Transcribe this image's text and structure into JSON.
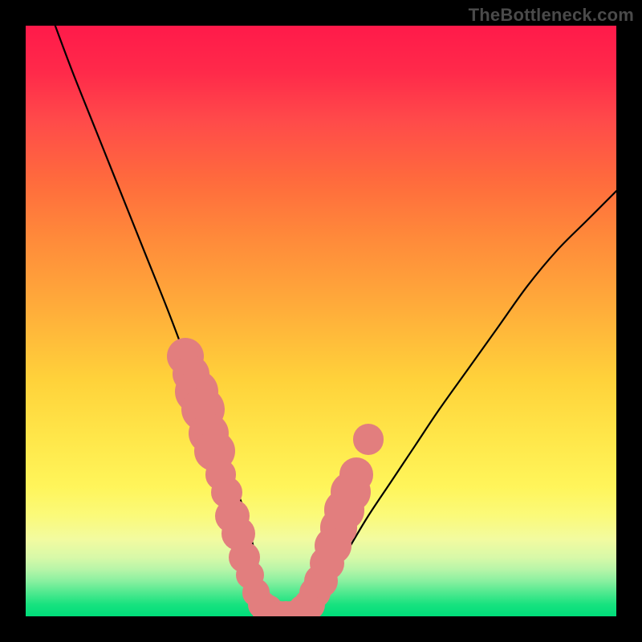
{
  "watermark": "TheBottleneck.com",
  "chart_data": {
    "type": "line",
    "title": "",
    "xlabel": "",
    "ylabel": "",
    "xlim": [
      0,
      100
    ],
    "ylim": [
      0,
      100
    ],
    "grid": false,
    "legend": false,
    "series": [
      {
        "name": "bottleneck-curve",
        "x": [
          5,
          8,
          12,
          16,
          20,
          24,
          27,
          29,
          31,
          33,
          35,
          37,
          38,
          39,
          40,
          41,
          42,
          43,
          45,
          47,
          49,
          52,
          55,
          58,
          62,
          66,
          70,
          75,
          80,
          85,
          90,
          95,
          100
        ],
        "y": [
          100,
          92,
          82,
          72,
          62,
          52,
          44,
          38,
          33,
          28,
          23,
          18,
          14,
          10,
          6,
          3,
          1,
          0,
          0,
          1,
          3,
          7,
          12,
          17,
          23,
          29,
          35,
          42,
          49,
          56,
          62,
          67,
          72
        ]
      }
    ],
    "markers": {
      "name": "highlight-dots",
      "color": "#e27e7e",
      "points": [
        {
          "x": 27,
          "y": 44,
          "r": 2.0
        },
        {
          "x": 28,
          "y": 41,
          "r": 2.0
        },
        {
          "x": 29,
          "y": 38,
          "r": 2.4
        },
        {
          "x": 30,
          "y": 35,
          "r": 2.4
        },
        {
          "x": 31,
          "y": 31,
          "r": 2.2
        },
        {
          "x": 32,
          "y": 28,
          "r": 2.2
        },
        {
          "x": 33,
          "y": 24,
          "r": 1.6
        },
        {
          "x": 34,
          "y": 21,
          "r": 1.6
        },
        {
          "x": 35,
          "y": 17,
          "r": 1.8
        },
        {
          "x": 36,
          "y": 14,
          "r": 1.8
        },
        {
          "x": 37,
          "y": 10,
          "r": 1.6
        },
        {
          "x": 38,
          "y": 7,
          "r": 1.4
        },
        {
          "x": 39,
          "y": 4,
          "r": 1.4
        },
        {
          "x": 40,
          "y": 2,
          "r": 1.4
        },
        {
          "x": 41,
          "y": 1,
          "r": 1.6
        },
        {
          "x": 42,
          "y": 0,
          "r": 1.6
        },
        {
          "x": 43,
          "y": 0,
          "r": 1.6
        },
        {
          "x": 44,
          "y": 0,
          "r": 1.6
        },
        {
          "x": 45,
          "y": 0,
          "r": 1.6
        },
        {
          "x": 46,
          "y": 0,
          "r": 1.6
        },
        {
          "x": 47,
          "y": 1,
          "r": 1.6
        },
        {
          "x": 48,
          "y": 2,
          "r": 1.6
        },
        {
          "x": 49,
          "y": 4,
          "r": 1.6
        },
        {
          "x": 50,
          "y": 6,
          "r": 1.8
        },
        {
          "x": 51,
          "y": 9,
          "r": 1.8
        },
        {
          "x": 52,
          "y": 12,
          "r": 2.0
        },
        {
          "x": 53,
          "y": 15,
          "r": 2.0
        },
        {
          "x": 54,
          "y": 18,
          "r": 2.2
        },
        {
          "x": 55,
          "y": 21,
          "r": 2.2
        },
        {
          "x": 56,
          "y": 24,
          "r": 1.8
        },
        {
          "x": 58,
          "y": 30,
          "r": 1.6
        }
      ]
    }
  }
}
